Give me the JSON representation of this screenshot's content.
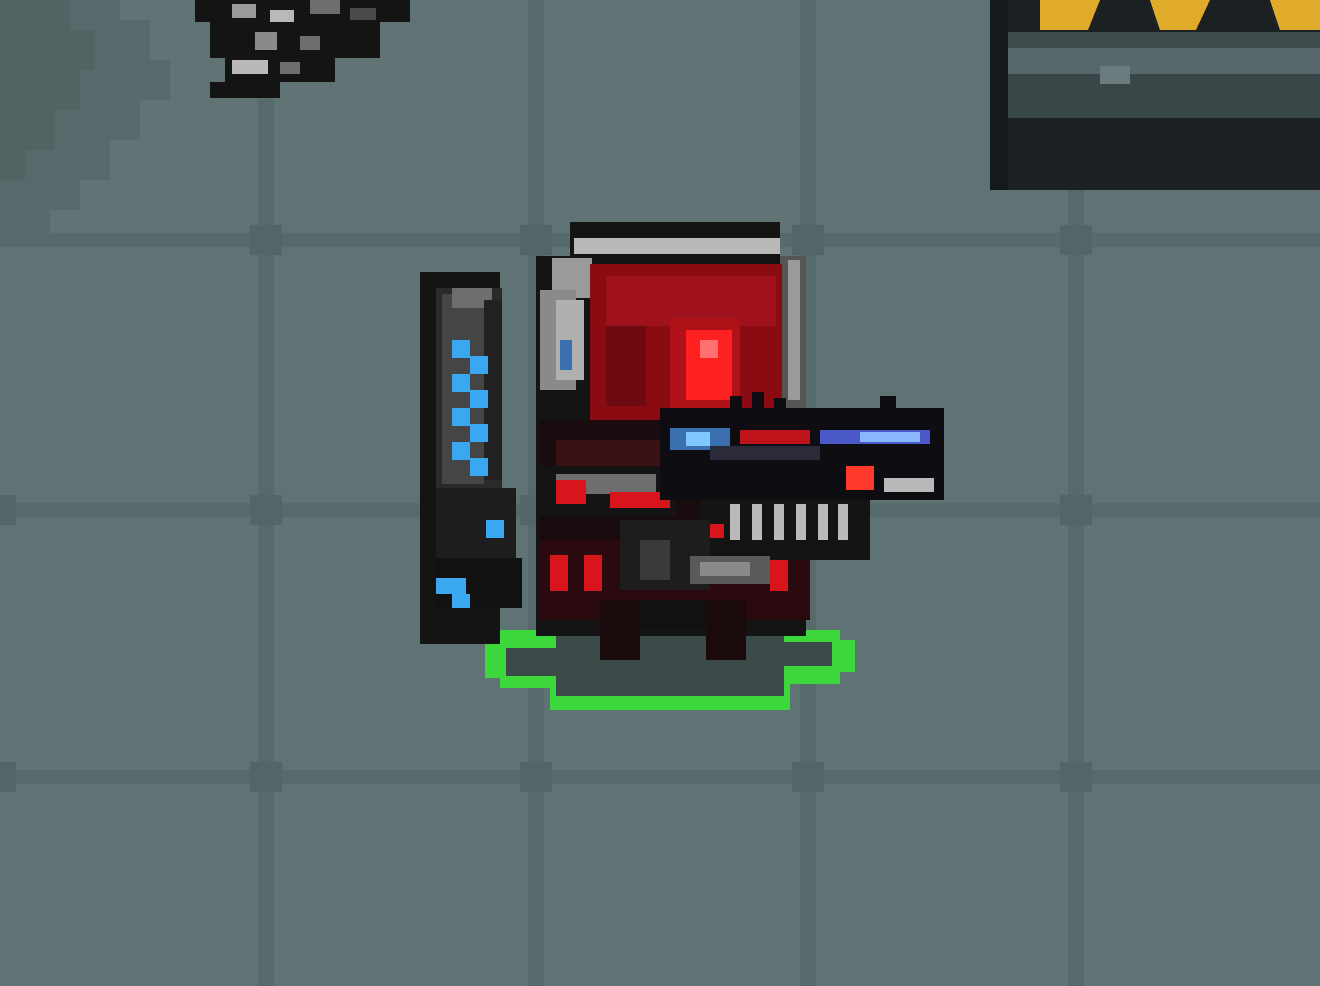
{
  "scene": {
    "kind": "top-down pixel-art dungeon room",
    "floor": {
      "tile_color": "#607374",
      "grout_color": "#556769",
      "stain_color": "#566869"
    },
    "player": {
      "sprite": "red-visor-armored-robot",
      "weapon": "heavy-assault-rifle",
      "backpack_energy_level": 0.8,
      "selection_ring_color": "#3bd73b"
    },
    "props": [
      {
        "type": "hazard-striped-crate",
        "stripe_color": "#e0aa2a"
      },
      {
        "type": "debris-pile"
      }
    ],
    "colors": {
      "visor": "#8b0b12",
      "eye": "#ff2020",
      "energy": "#3aa8f0",
      "armor_dark": "#141414",
      "armor_mid": "#6e6e6e",
      "armor_light": "#b9b9b9"
    }
  }
}
